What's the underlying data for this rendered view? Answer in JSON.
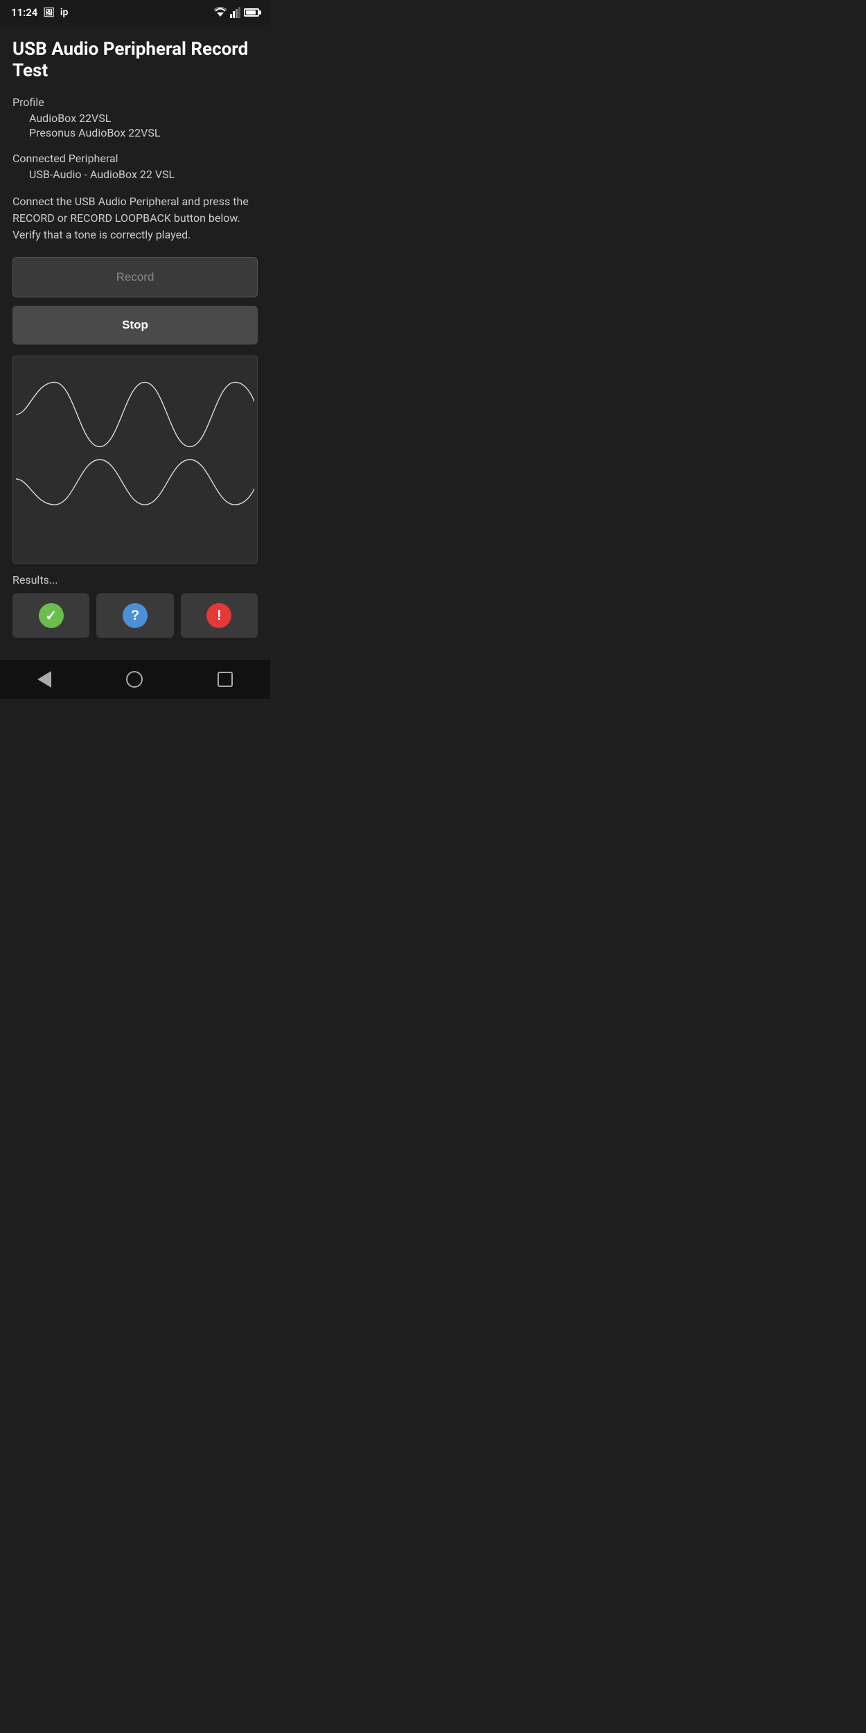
{
  "statusBar": {
    "time": "11:24",
    "leftIcons": [
      "image-icon",
      "ip-icon"
    ],
    "ipLabel": "ip"
  },
  "header": {
    "title": "USB Audio Peripheral Record Test"
  },
  "profile": {
    "label": "Profile",
    "line1": "AudioBox 22VSL",
    "line2": "Presonus AudioBox 22VSL"
  },
  "connectedPeripheral": {
    "label": "Connected Peripheral",
    "value": "USB-Audio - AudioBox 22 VSL"
  },
  "instruction": "Connect the USB Audio Peripheral and press the RECORD or RECORD LOOPBACK button below. Verify that a tone is correctly played.",
  "buttons": {
    "record": "Record",
    "stop": "Stop"
  },
  "results": {
    "label": "Results...",
    "buttons": [
      {
        "type": "check",
        "ariaLabel": "Pass"
      },
      {
        "type": "question",
        "ariaLabel": "Unknown"
      },
      {
        "type": "exclaim",
        "ariaLabel": "Fail"
      }
    ]
  },
  "navBar": {
    "back": "back",
    "home": "home",
    "recent": "recent"
  },
  "waveform": {
    "channels": 2,
    "description": "sine wave visualization"
  }
}
